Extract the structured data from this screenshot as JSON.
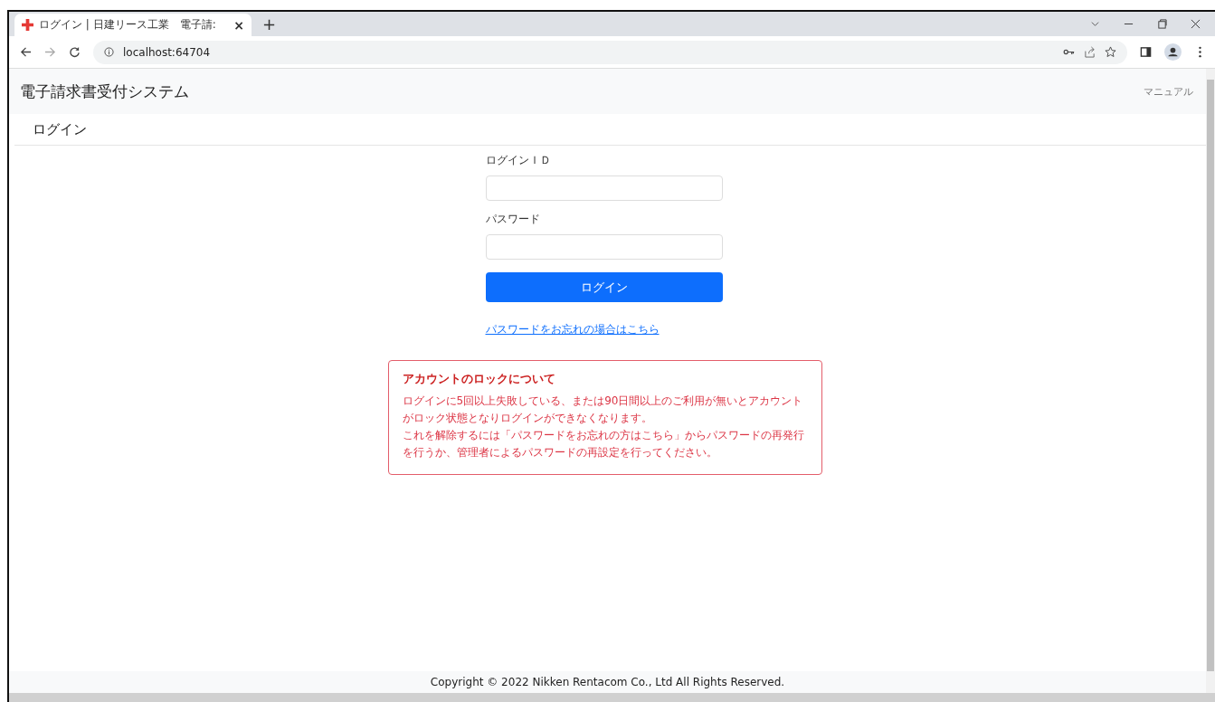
{
  "browser": {
    "tab": {
      "title": "ログイン | 日建リース工業　電子請:",
      "close": "×"
    },
    "new_tab": "+",
    "url": "localhost:64704"
  },
  "header": {
    "title": "電子請求書受付システム",
    "manual_link": "マニュアル"
  },
  "page_title": "ログイン",
  "form": {
    "fields": [
      {
        "label": "ログインＩＤ"
      },
      {
        "label": "パスワード"
      }
    ],
    "submit": "ログイン",
    "forgot_link": "パスワードをお忘れの場合はこちら"
  },
  "notice": {
    "title": "アカウントのロックについて",
    "paragraphs": [
      "ログインに5回以上失敗している、または90日間以上のご利用が無いとアカウントがロック状態となりログインができなくなります。",
      "これを解除するには「パスワードをお忘れの方はこちら」からパスワードの再発行を行うか、管理者によるパスワードの再設定を行ってください。"
    ]
  },
  "footer": "Copyright © 2022 Nikken Rentacom Co., Ltd All Rights Reserved."
}
